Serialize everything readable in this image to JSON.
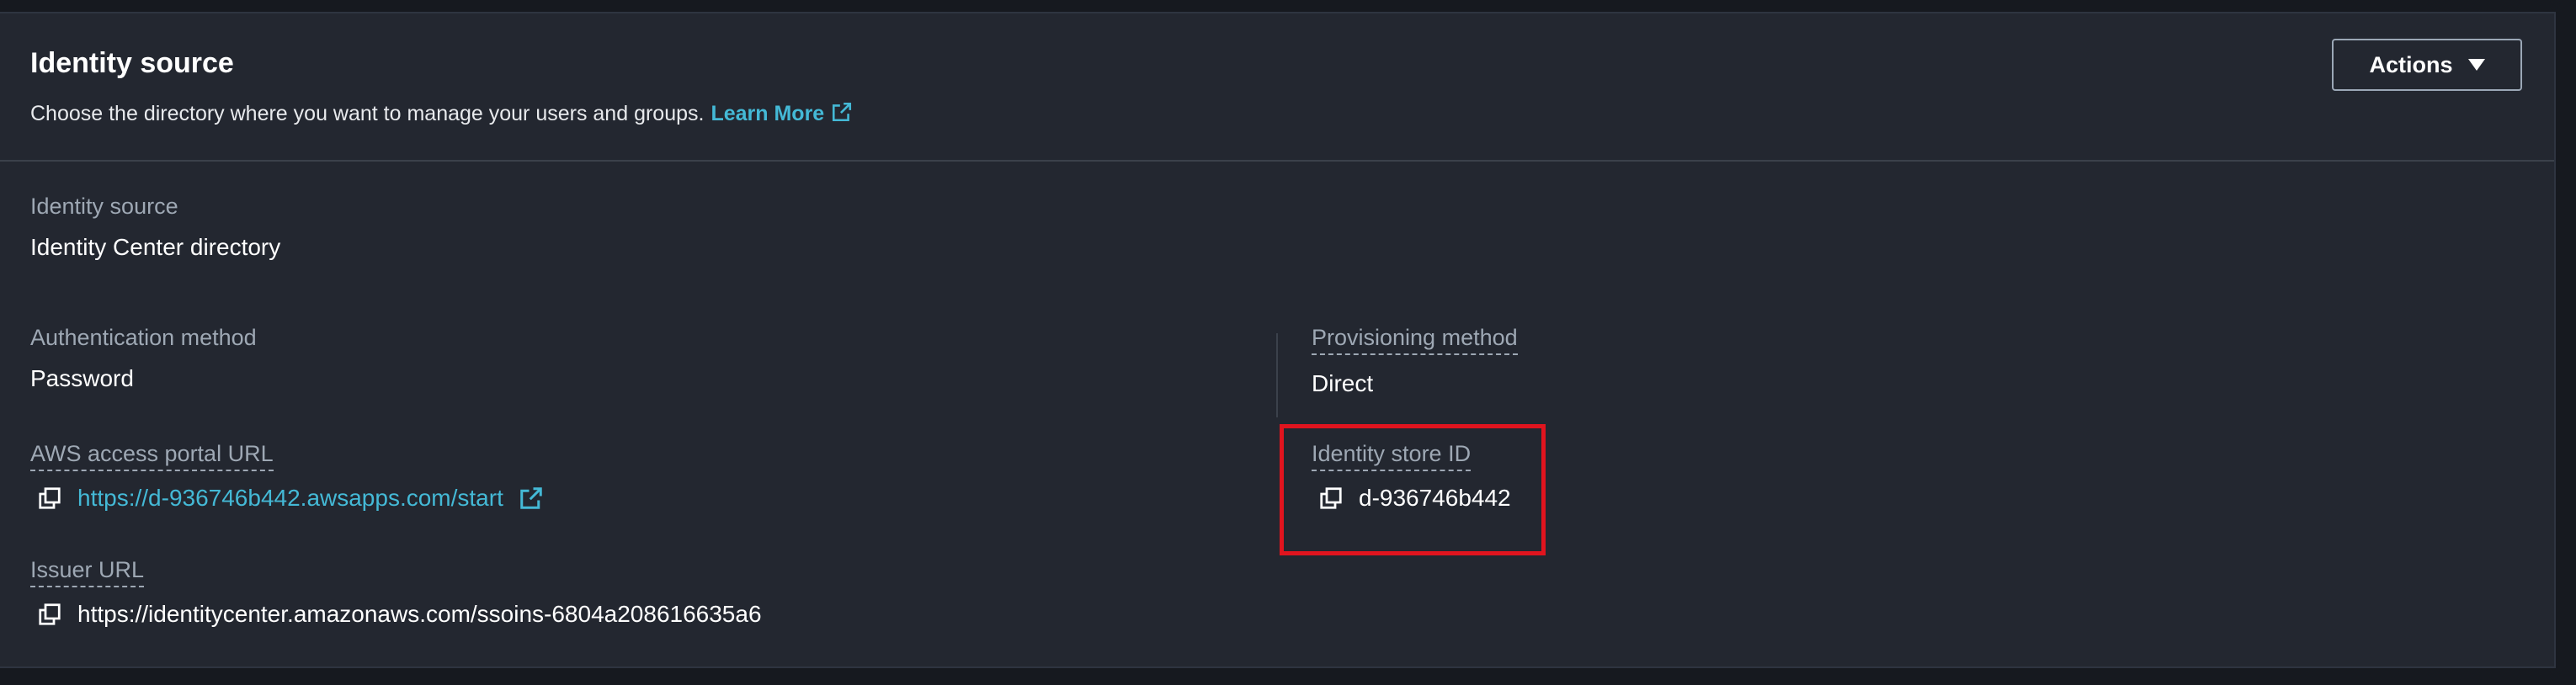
{
  "header": {
    "title": "Identity source",
    "description": "Choose the directory where you want to manage your users and groups.",
    "learn_more": "Learn More",
    "actions_label": "Actions"
  },
  "fields": {
    "identity_source": {
      "label": "Identity source",
      "value": "Identity Center directory"
    },
    "authentication_method": {
      "label": "Authentication method",
      "value": "Password"
    },
    "provisioning_method": {
      "label": "Provisioning method",
      "value": "Direct"
    },
    "portal_url": {
      "label": "AWS access portal URL",
      "value": "https://d-936746b442.awsapps.com/start"
    },
    "identity_store_id": {
      "label": "Identity store ID",
      "value": "d-936746b442"
    },
    "issuer_url": {
      "label": "Issuer URL",
      "value": "https://identitycenter.amazonaws.com/ssoins-6804a208616635a6"
    }
  },
  "icons": {
    "external_link": "external-link-icon",
    "copy": "copy-icon",
    "dropdown": "caret-down-icon"
  },
  "colors": {
    "page_background": "#16191f",
    "panel_background": "#232730",
    "link": "#44b9d6",
    "label": "#9ea8b4",
    "highlight": "#e0141e"
  }
}
